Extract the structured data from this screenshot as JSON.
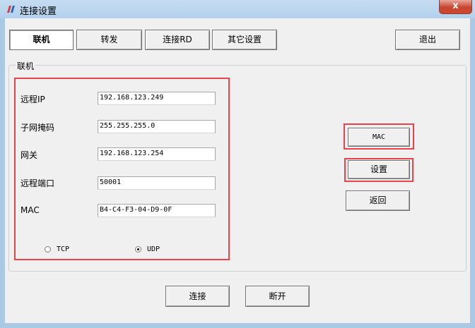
{
  "window": {
    "title": "连接设置",
    "close_label": "x"
  },
  "toolbar": {
    "tab_connect": "联机",
    "tab_forward": "转发",
    "tab_connect_rd": "连接RD",
    "tab_other": "其它设置",
    "exit": "退出"
  },
  "group": {
    "title": "联机",
    "fields": [
      {
        "label": "远程IP",
        "value": "192.168.123.249"
      },
      {
        "label": "子网掩码",
        "value": "255.255.255.0"
      },
      {
        "label": "网关",
        "value": "192.168.123.254"
      },
      {
        "label": "远程端口",
        "value": "50001"
      },
      {
        "label": "MAC",
        "value": "B4-C4-F3-04-D9-0F"
      }
    ],
    "protocol": {
      "options": [
        "TCP",
        "UDP"
      ],
      "selected": "UDP"
    },
    "side_buttons": {
      "mac": "MAC",
      "set": "设置",
      "back": "返回"
    }
  },
  "bottom": {
    "connect": "连接",
    "disconnect": "断开"
  },
  "colors": {
    "highlight": "#e8424b",
    "titlebar": "#b9d4ee",
    "close": "#c7452f"
  }
}
